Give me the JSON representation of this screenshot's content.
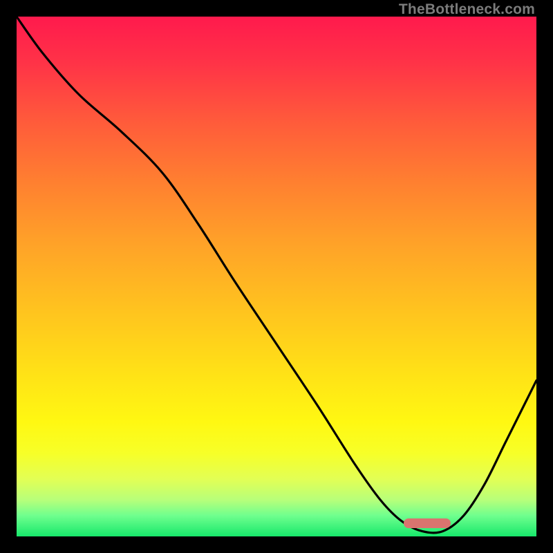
{
  "watermark": "TheBottleneck.com",
  "gradient_colors": {
    "top": "#ff1a4d",
    "mid_upper": "#ff8030",
    "mid": "#ffe017",
    "mid_lower": "#f7ff28",
    "bottom": "#17e86b"
  },
  "marker": {
    "color": "#d9746f",
    "x_start_frac": 0.745,
    "x_end_frac": 0.835,
    "y_frac": 0.975
  },
  "chart_data": {
    "type": "line",
    "title": "",
    "xlabel": "",
    "ylabel": "",
    "xlim": [
      0,
      100
    ],
    "ylim": [
      0,
      100
    ],
    "grid": false,
    "legend": false,
    "series": [
      {
        "name": "curve",
        "x": [
          0,
          5,
          12,
          20,
          28,
          35,
          42,
          50,
          58,
          65,
          70,
          74,
          78,
          82,
          86,
          90,
          94,
          98,
          100
        ],
        "y": [
          100,
          93,
          85,
          78,
          70,
          60,
          49,
          37,
          25,
          14,
          7,
          3,
          1,
          1,
          4,
          10,
          18,
          26,
          30
        ]
      }
    ],
    "annotations": [
      {
        "type": "highlight-band",
        "axis": "x",
        "start": 74.5,
        "end": 83.5,
        "y": 2.5,
        "color": "#d9746f"
      }
    ]
  }
}
